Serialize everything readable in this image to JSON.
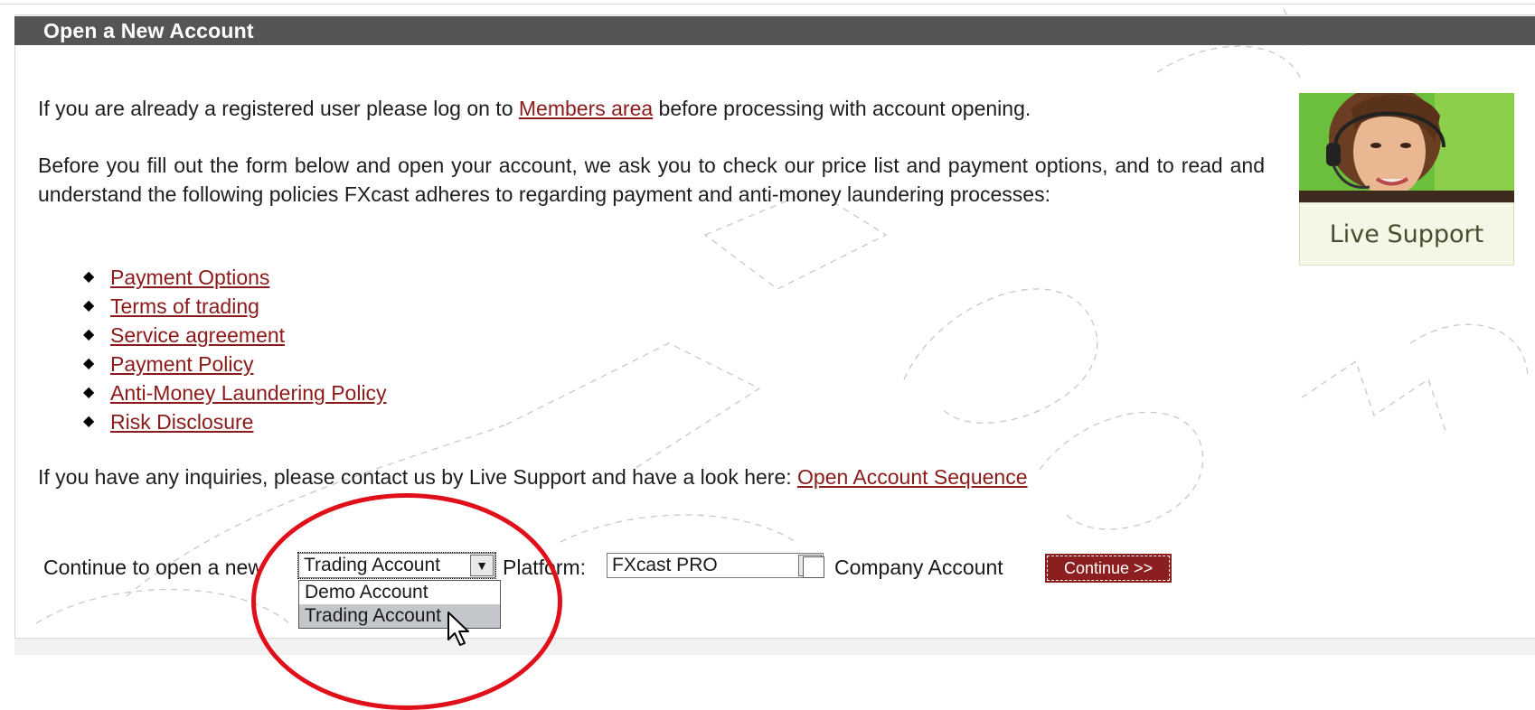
{
  "header": {
    "title": "Open a New Account"
  },
  "intro": {
    "before_link": "If you are already a registered user please log on to ",
    "members_link": "Members area",
    "after_link": " before processing with account opening."
  },
  "policies_intro": "Before you fill out the form below and open your account, we ask you to check our price list and payment options, and to read and understand the following policies FXcast adheres to regarding payment and anti-money laundering processes:",
  "policies": [
    {
      "label": "Payment Options"
    },
    {
      "label": "Terms of trading"
    },
    {
      "label": "Service agreement"
    },
    {
      "label": "Payment Policy"
    },
    {
      "label": "Anti-Money Laundering Policy"
    },
    {
      "label": "Risk Disclosure"
    }
  ],
  "inquiry": {
    "text": "If you have any inquiries, please contact us by Live Support and have a look here: ",
    "link": "Open Account Sequence"
  },
  "form": {
    "continue_prefix": "Continue to open a new",
    "account_type": {
      "selected": "Trading Account",
      "options": [
        "Demo Account",
        "Trading Account"
      ],
      "highlighted": "Trading Account"
    },
    "platform_label": "Platform:",
    "platform": {
      "selected": "FXcast PRO"
    },
    "company_label": "Company Account",
    "company_checked": false,
    "continue_button": "Continue >>"
  },
  "support": {
    "label": "Live Support"
  },
  "colors": {
    "header_bg": "#555555",
    "link": "#8b1a1a",
    "button_bg": "#8b1e1e",
    "annotation": "#e0101a",
    "support_bg": "#f4f7e6"
  }
}
